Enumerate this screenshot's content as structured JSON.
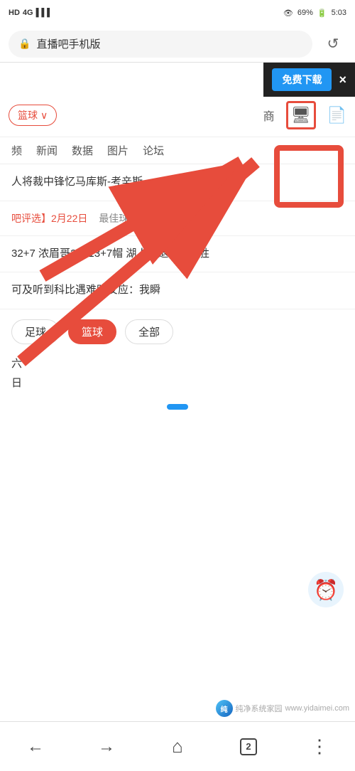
{
  "statusBar": {
    "left": [
      "HD",
      "4G",
      "signal"
    ],
    "battery": "69%",
    "time": "5:03"
  },
  "addressBar": {
    "url": "直播吧手机版",
    "lockIcon": "🔒"
  },
  "adBanner": {
    "downloadLabel": "免费下载",
    "closeLabel": "×"
  },
  "navTabs": {
    "dropdown": "篮球",
    "dropdownArrow": "∨",
    "tabIcons": [
      "商",
      "🖥",
      "📄"
    ]
  },
  "subNav": {
    "items": [
      "频",
      "新闻",
      "数据",
      "图片",
      "论坛"
    ]
  },
  "newsItems": [
    {
      "text": "人将裁中锋忆马库斯-考辛斯"
    },
    {
      "date": "吧评选】2月22日",
      "badge": "最佳球员"
    },
    {
      "text": "32+7 浓眉哥28+13+7帽 湖人击退 来4连胜"
    },
    {
      "text": "可及听到科比遇难时反应：我瞬"
    }
  ],
  "filterTabs": {
    "items": [
      "足球",
      "篮球",
      "全部"
    ],
    "activeIndex": 1
  },
  "dayLabels": {
    "lines": [
      "六",
      "日"
    ]
  },
  "bottomNav": {
    "back": "←",
    "forward": "→",
    "home": "⌂",
    "tabs": "2",
    "menu": "⋮"
  },
  "watermark": {
    "text": "纯净系统家园",
    "url": "www.yidaimei.com"
  }
}
